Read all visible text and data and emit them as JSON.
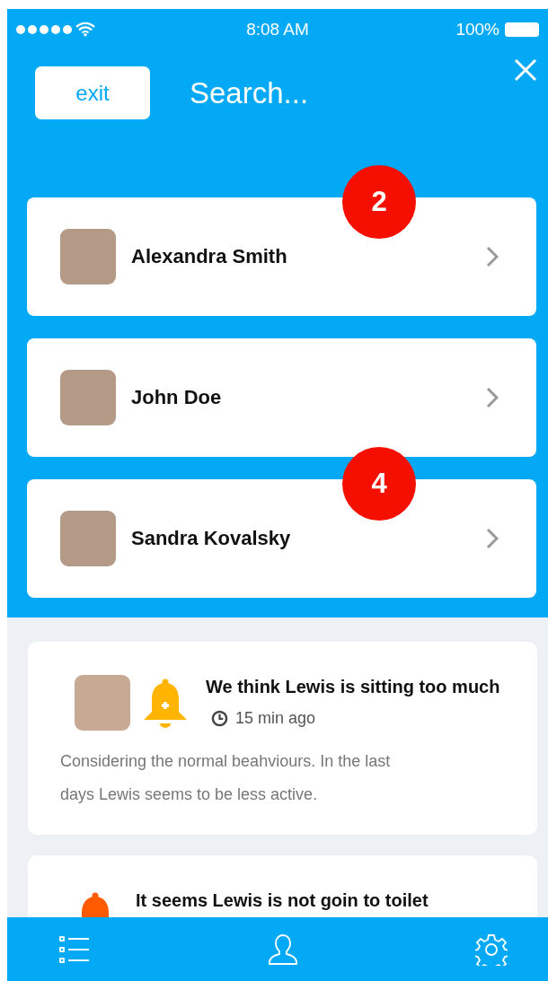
{
  "status_bar": {
    "time": "8:08 AM",
    "battery": "100%"
  },
  "header": {
    "exit_button": "exit",
    "search": {
      "placeholder": "Search..."
    }
  },
  "contacts": [
    {
      "name": "Alexandra Smith",
      "badge": "2"
    },
    {
      "name": "John Doe"
    },
    {
      "name": "Sandra Kovalsky",
      "badge": "4"
    }
  ],
  "notifications": [
    {
      "has_photo": true,
      "kind": "add",
      "color": "#ffb400",
      "title": "We think Lewis is sitting too much",
      "time": "15 min ago",
      "text": "Considering the normal beahviours. In the last days Lewis seems to be less active."
    },
    {
      "has_photo": false,
      "kind": "plain",
      "color": "#ff5a00",
      "title": "It seems Lewis is not goin to toilet"
    }
  ],
  "tab_bar": {
    "items": [
      {
        "kind": "list"
      },
      {
        "kind": "profile"
      },
      {
        "kind": "settings"
      }
    ]
  }
}
